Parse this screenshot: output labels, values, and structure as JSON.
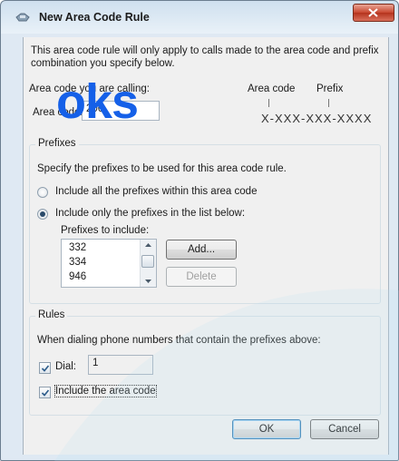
{
  "window": {
    "title": "New Area Code Rule",
    "close_label": "x"
  },
  "intro": {
    "text": "This area code rule will only apply to calls made to the area code and prefix combination you specify below."
  },
  "watermark": "oks",
  "area_code": {
    "calling_label": "Area code you are calling:",
    "field_label": "Area code:",
    "value": "206"
  },
  "diagram": {
    "area_code_label": "Area code",
    "prefix_label": "Prefix",
    "pattern": "X-XXX-XXX-XXXX"
  },
  "prefixes": {
    "group_title": "Prefixes",
    "description": "Specify the prefixes to be used for this area code rule.",
    "option_all": "Include all the prefixes within this area code",
    "option_list": "Include only the prefixes in the list below:",
    "selected_option": "option_list",
    "list_label": "Prefixes to include:",
    "items": [
      "332",
      "334",
      "946"
    ],
    "add_button": "Add...",
    "delete_button": "Delete"
  },
  "rules": {
    "group_title": "Rules",
    "description": "When dialing phone numbers that contain the prefixes above:",
    "dial_label": "Dial:",
    "dial_checked": true,
    "dial_value": "1",
    "include_area_code_label": "Include the area code",
    "include_area_code_checked": true
  },
  "buttons": {
    "ok": "OK",
    "cancel": "Cancel"
  },
  "colors": {
    "accent": "#3c7fb1",
    "watermark": "#1560e8",
    "close_button": "#c8472f"
  }
}
